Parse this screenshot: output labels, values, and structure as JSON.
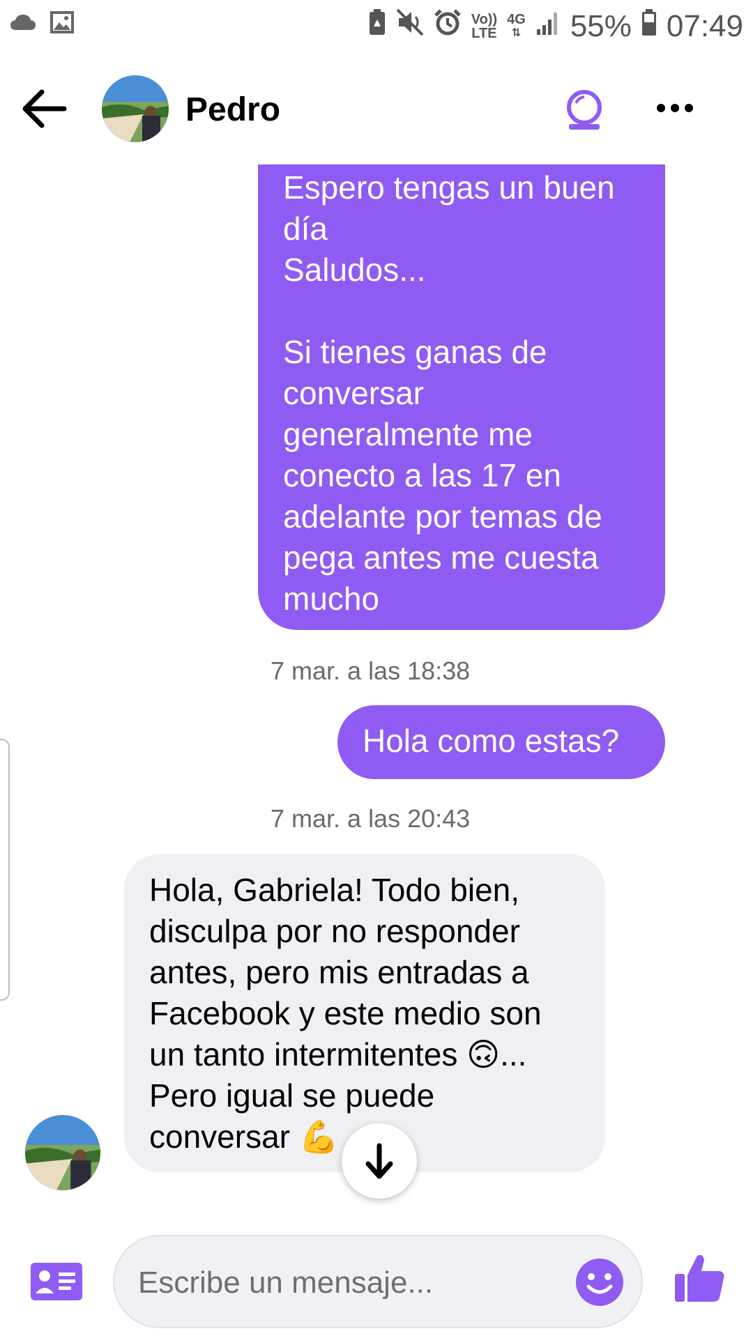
{
  "status_bar": {
    "battery_percent": "55%",
    "time": "07:49",
    "network_label": "4G",
    "volte_label_top": "Vo))",
    "volte_label_bottom": "LTE"
  },
  "header": {
    "contact_name": "Pedro"
  },
  "messages": {
    "sent_long": {
      "lines": [
        "Espero tengas un buen",
        "día",
        "Saludos...",
        "",
        "Si tienes ganas de",
        "conversar",
        "generalmente me",
        "conecto a las 17 en",
        "adelante por temas de",
        "pega antes me cuesta",
        "mucho"
      ]
    },
    "timestamp_1": "7 mar. a las 18:38",
    "sent_short": "Hola como estas?",
    "timestamp_2": "7 mar. a las 20:43",
    "received": {
      "lines": [
        "Hola, Gabriela! Todo bien,",
        "disculpa por no responder",
        "antes, pero mis entradas a",
        "Facebook y este medio son",
        "un tanto intermitentes 🙃...",
        "Pero igual se puede",
        "conversar 💪"
      ]
    }
  },
  "composer": {
    "placeholder": "Escribe un mensaje..."
  },
  "colors": {
    "accent": "#8f5bf2",
    "received_bubble": "#f0f0f4",
    "timestamp": "#6a6a6a"
  },
  "icons": [
    "cloud-icon",
    "image-icon",
    "battery-saver-icon",
    "mute-icon",
    "alarm-icon",
    "signal-icon",
    "battery-icon",
    "back-arrow-icon",
    "video-call-icon",
    "more-icon",
    "arrow-down-icon",
    "contact-card-icon",
    "emoji-icon",
    "thumbs-up-icon"
  ]
}
